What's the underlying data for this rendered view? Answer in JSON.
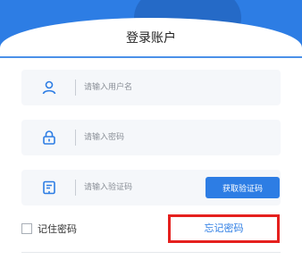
{
  "header": {
    "title": "登录账户"
  },
  "form": {
    "username_placeholder": "请输入用户名",
    "password_placeholder": "请输入密码",
    "code_placeholder": "请输入验证码",
    "get_code_button": "获取验证码"
  },
  "options": {
    "remember_label": "记住密码",
    "forgot_label": "忘记密码"
  },
  "colors": {
    "accent": "#2d7de4",
    "highlight_border": "#e5201e"
  },
  "icons": {
    "username": "user-icon",
    "password": "lock-icon",
    "code": "verification-code-icon"
  }
}
